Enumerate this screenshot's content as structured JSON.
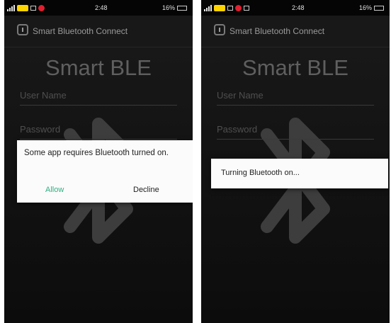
{
  "colors": {
    "background": "#111111",
    "allow_accent": "#2fb083",
    "dialog_bg": "#fbfbfb",
    "badge_yellow": "#ffd400",
    "notification_red": "#e02030"
  },
  "left_screen": {
    "status_bar": {
      "time": "2:48",
      "battery": "16%"
    },
    "app_bar": {
      "title": "Smart Bluetooth Connect",
      "icon": "bluetooth-app-icon"
    },
    "main": {
      "title": "Smart BLE",
      "username_placeholder": "User Name",
      "password_placeholder": "Password",
      "background_icon": "bluetooth-icon"
    },
    "dialog": {
      "message": "Some app requires Bluetooth turned on.",
      "allow_label": "Allow",
      "decline_label": "Decline"
    }
  },
  "right_screen": {
    "status_bar": {
      "time": "2:48",
      "battery": "16%"
    },
    "app_bar": {
      "title": "Smart Bluetooth Connect",
      "icon": "bluetooth-app-icon"
    },
    "main": {
      "title": "Smart BLE",
      "username_placeholder": "User Name",
      "password_placeholder": "Password",
      "background_icon": "bluetooth-icon"
    },
    "dialog": {
      "message": "Turning Bluetooth on..."
    }
  }
}
